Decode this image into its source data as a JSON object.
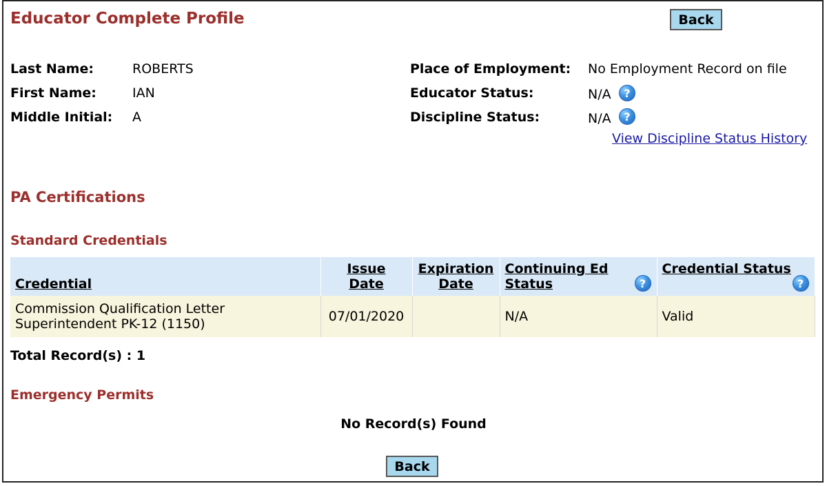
{
  "page": {
    "title": "Educator Complete Profile",
    "back_label": "Back"
  },
  "profile": {
    "last_name_label": "Last Name:",
    "last_name": "ROBERTS",
    "first_name_label": "First Name:",
    "first_name": "IAN",
    "middle_initial_label": "Middle Initial:",
    "middle_initial": "A",
    "employment_label": "Place of Employment:",
    "employment": "No Employment Record on file",
    "educator_status_label": "Educator Status:",
    "educator_status": "N/A",
    "discipline_status_label": "Discipline Status:",
    "discipline_status": "N/A",
    "discipline_history_link": "View Discipline Status History"
  },
  "sections": {
    "certifications": "PA Certifications",
    "standard_credentials": "Standard Credentials",
    "emergency_permits": "Emergency Permits"
  },
  "credentials_table": {
    "headers": {
      "credential": "Credential",
      "issue_date_1": "Issue",
      "issue_date_2": "Date",
      "expiration_date_1": "Expiration",
      "expiration_date_2": "Date",
      "ce_status_1": "Continuing Ed",
      "ce_status_2": "Status",
      "credential_status": "Credential Status"
    },
    "rows": [
      {
        "credential_line1": "Commission Qualification Letter",
        "credential_line2": "Superintendent PK-12 (1150)",
        "issue_date": "07/01/2020",
        "expiration_date": "",
        "ce_status": "N/A",
        "credential_status": "Valid"
      }
    ],
    "total": "Total Record(s) : 1"
  },
  "emergency_permits": {
    "empty_message": "No Record(s) Found"
  },
  "icons": {
    "help": "question-mark-help-icon",
    "help_glyph": "?"
  },
  "colors": {
    "heading": "#9b2f2c",
    "button_bg": "#a8d8ee",
    "table_header_bg": "#d9e9f8",
    "table_row_bg": "#f7f5dd",
    "link": "#1a1aa6"
  }
}
